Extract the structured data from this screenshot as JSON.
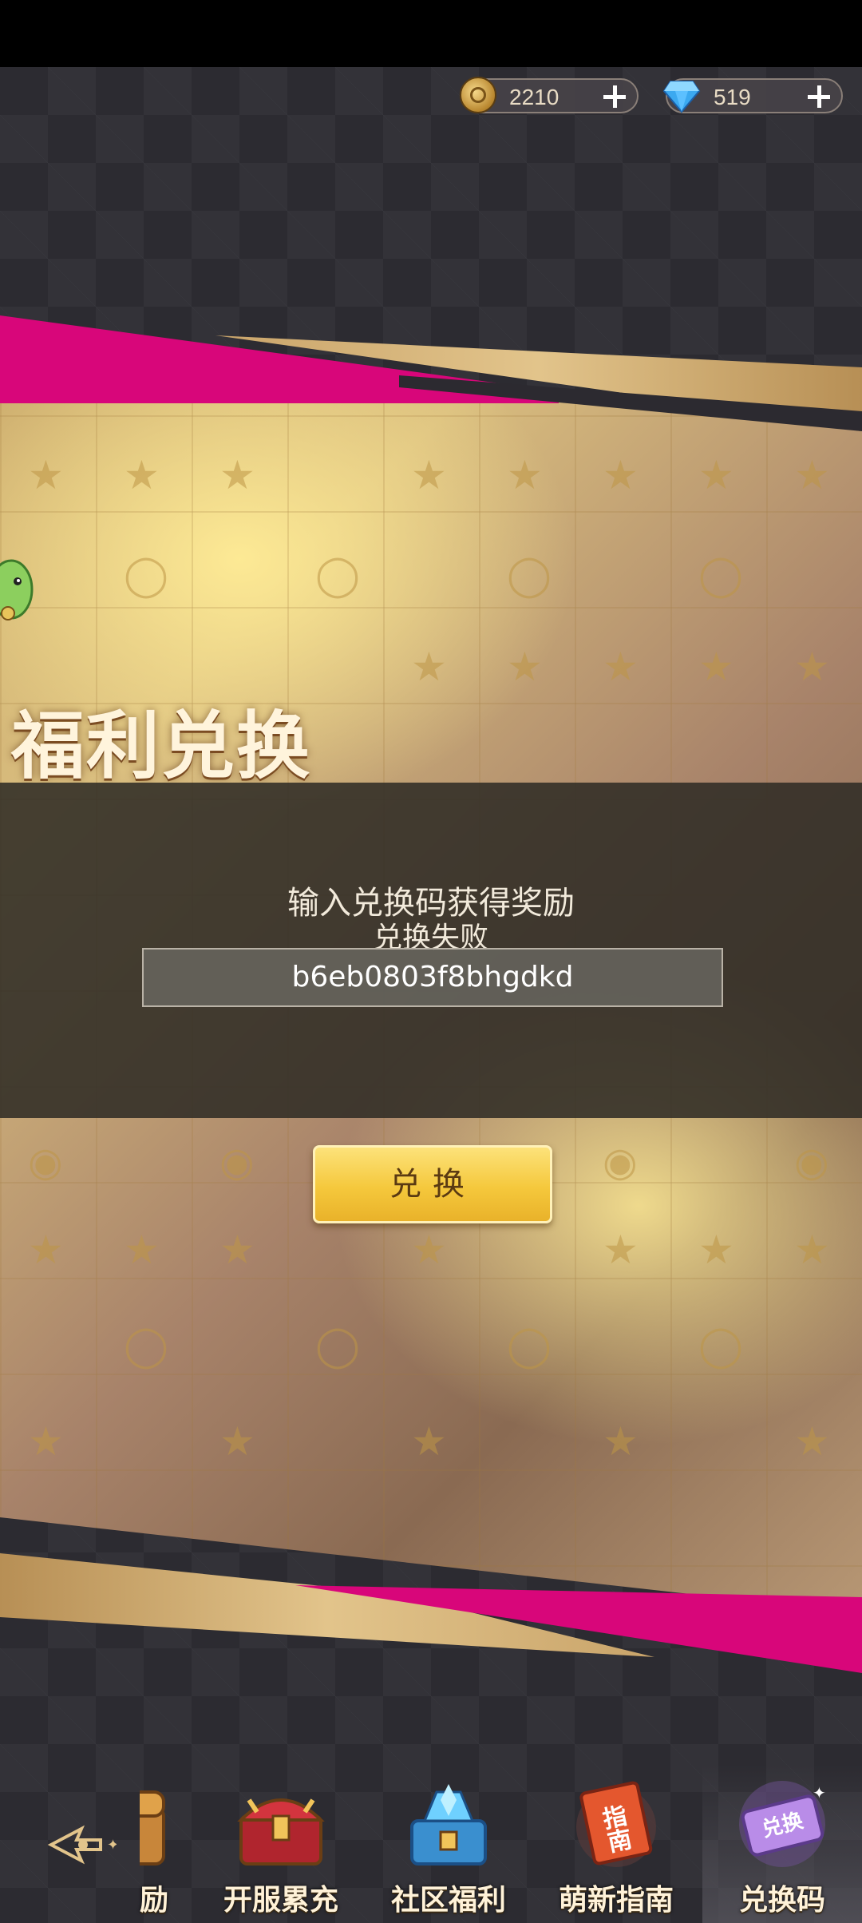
{
  "currencies": {
    "gold": {
      "icon": "coin-icon",
      "value": "2210"
    },
    "diamond": {
      "icon": "gem-icon",
      "value": "519"
    }
  },
  "banner": {
    "title": "福利兑换",
    "prompt": "输入兑换码获得奖励",
    "status": "兑换失败",
    "code_value": "b6eb0803f8bhgdkd",
    "button_label": "兑换"
  },
  "nav": {
    "items": [
      {
        "label": "励",
        "icon": "reward-chest-icon"
      },
      {
        "label": "开服累充",
        "icon": "treasure-chest-icon"
      },
      {
        "label": "社区福利",
        "icon": "gem-chest-icon"
      },
      {
        "label": "萌新指南",
        "icon": "guide-book-icon"
      },
      {
        "label": "兑换码",
        "icon": "redeem-ticket-icon"
      }
    ],
    "guide_icon_text": "指南",
    "ticket_icon_text": "兑换"
  },
  "colors": {
    "pink": "#d8067a",
    "gold": "#e2c48b",
    "button": "#f5c83c"
  }
}
